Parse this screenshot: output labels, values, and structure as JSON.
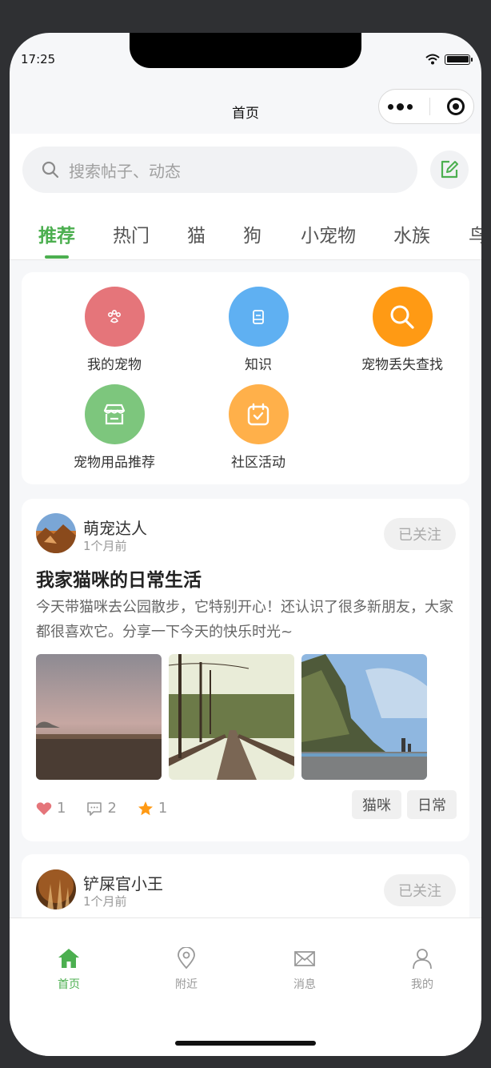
{
  "status": {
    "time": "17:25"
  },
  "nav": {
    "title": "首页"
  },
  "search": {
    "placeholder": "搜索帖子、动态",
    "icon": "search-icon",
    "edit_icon": "edit-icon"
  },
  "tabs": [
    {
      "label": "推荐",
      "active": true
    },
    {
      "label": "热门"
    },
    {
      "label": "猫"
    },
    {
      "label": "狗"
    },
    {
      "label": "小宠物"
    },
    {
      "label": "水族"
    },
    {
      "label": "鸟"
    }
  ],
  "shortcuts": [
    {
      "label": "我的宠物",
      "icon": "paw-icon",
      "color": "#e5757a"
    },
    {
      "label": "知识",
      "icon": "book-icon",
      "color": "#5fb0f2"
    },
    {
      "label": "宠物丢失查找",
      "icon": "search-icon",
      "color": "#ff9a14"
    },
    {
      "label": "宠物用品推荐",
      "icon": "store-icon",
      "color": "#7dc67d"
    },
    {
      "label": "社区活动",
      "icon": "calendar-check-icon",
      "color": "#ffb04a"
    }
  ],
  "posts": [
    {
      "author": "萌宠达人",
      "time": "1个月前",
      "follow_label": "已关注",
      "title": "我家猫咪的日常生活",
      "body": "今天带猫咪去公园散步，它特别开心！还认识了很多新朋友，大家都很喜欢它。分享一下今天的快乐时光~",
      "likes": "1",
      "comments": "2",
      "stars": "1",
      "tags": [
        "猫咪",
        "日常"
      ]
    },
    {
      "author": "铲屎官小王",
      "time": "1个月前",
      "follow_label": "已关注"
    }
  ],
  "tabbar": [
    {
      "label": "首页",
      "icon": "home-icon",
      "active": true
    },
    {
      "label": "附近",
      "icon": "location-pin-icon"
    },
    {
      "label": "消息",
      "icon": "mail-icon"
    },
    {
      "label": "我的",
      "icon": "user-icon"
    }
  ],
  "colors": {
    "accent": "#4caf50",
    "like": "#e5757a",
    "star": "#ff9a14"
  }
}
